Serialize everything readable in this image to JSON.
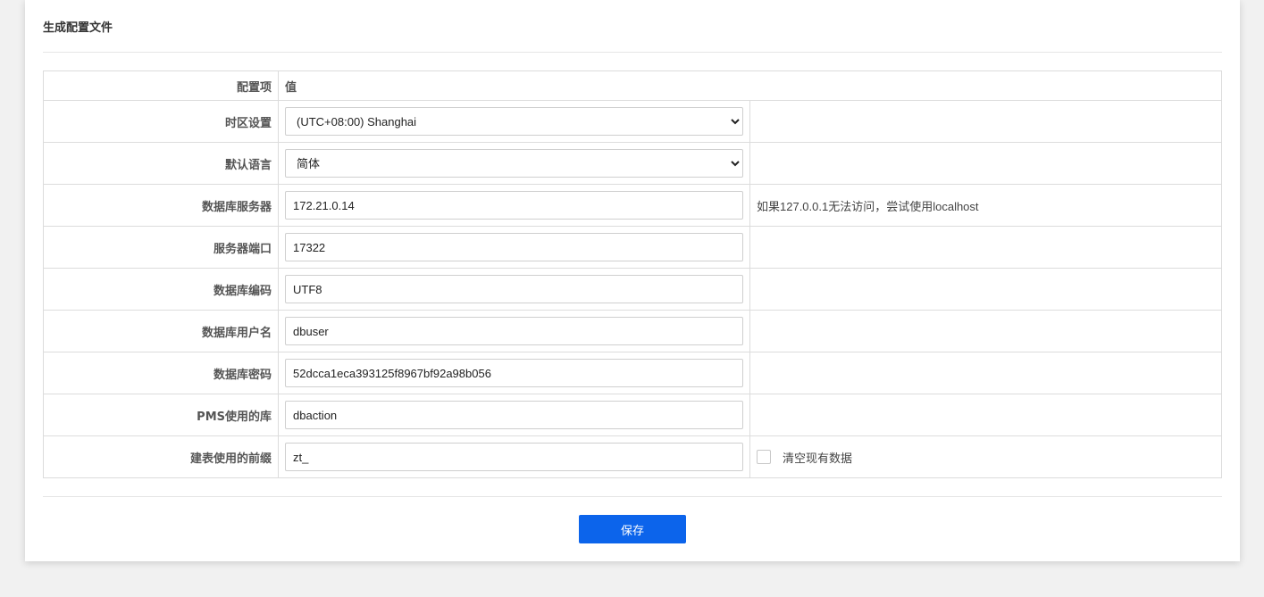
{
  "page": {
    "title": "生成配置文件"
  },
  "table": {
    "header_key": "配置项",
    "header_value": "值",
    "rows": [
      {
        "label": "时区设置",
        "type": "select",
        "value": "(UTC+08:00) Shanghai",
        "hint": ""
      },
      {
        "label": "默认语言",
        "type": "select",
        "value": "简体",
        "hint": ""
      },
      {
        "label": "数据库服务器",
        "type": "input",
        "value": "172.21.0.14",
        "hint": "如果127.0.0.1无法访问，尝试使用localhost"
      },
      {
        "label": "服务器端口",
        "type": "input",
        "value": "17322",
        "hint": ""
      },
      {
        "label": "数据库编码",
        "type": "input",
        "value": "UTF8",
        "hint": ""
      },
      {
        "label": "数据库用户名",
        "type": "input",
        "value": "dbuser",
        "hint": ""
      },
      {
        "label": "数据库密码",
        "type": "input",
        "value": "52dcca1eca393125f8967bf92a98b056",
        "hint": ""
      },
      {
        "label": "PMS使用的库",
        "type": "input",
        "value": "dbaction",
        "hint": ""
      },
      {
        "label": "建表使用的前缀",
        "type": "input",
        "value": "zt_",
        "hint": ""
      }
    ],
    "clear_data_label": "清空现有数据",
    "clear_data_checked": false
  },
  "actions": {
    "save_label": "保存"
  },
  "colors": {
    "primary": "#0c64eb",
    "border": "#dcdcdc"
  }
}
